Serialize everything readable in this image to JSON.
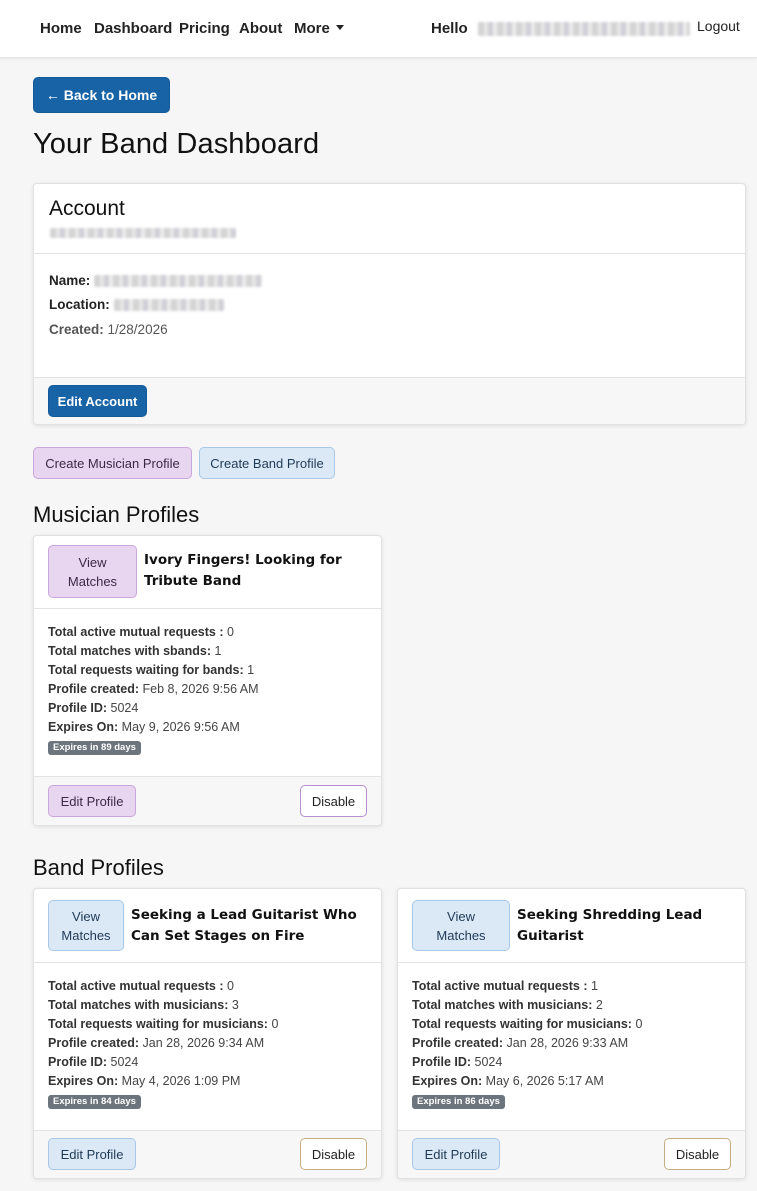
{
  "nav": {
    "items": [
      "Home",
      "Dashboard",
      "Pricing",
      "About"
    ],
    "more": "More",
    "hello": "Hello",
    "logout": "Logout"
  },
  "back_button": "← Back to Home",
  "page_title": "Your Band Dashboard",
  "account": {
    "title": "Account",
    "name_label": "Name:",
    "location_label": "Location:",
    "created_label": "Created:",
    "created_value": "1/28/2026",
    "edit_button": "Edit Account"
  },
  "actions": {
    "create_musician": "Create Musician Profile",
    "create_band": "Create Band Profile"
  },
  "musician_section": {
    "title": "Musician Profiles",
    "profiles": [
      {
        "view_matches": "View Matches",
        "title": "Ivory Fingers! Looking for Tribute Band",
        "stats": [
          {
            "label": "Total active mutual requests :",
            "value": "0"
          },
          {
            "label": "Total matches with sbands:",
            "value": "1"
          },
          {
            "label": "Total requests waiting for bands:",
            "value": "1"
          },
          {
            "label": "Profile created:",
            "value": "Feb 8, 2026 9:56 AM"
          },
          {
            "label": "Profile ID:",
            "value": "5024"
          },
          {
            "label": "Expires On:",
            "value": "May 9, 2026 9:56 AM"
          }
        ],
        "badge": "Expires in 89 days",
        "edit": "Edit Profile",
        "disable": "Disable"
      }
    ]
  },
  "band_section": {
    "title": "Band Profiles",
    "profiles": [
      {
        "view_matches": "View Matches",
        "title": "Seeking a Lead Guitarist Who Can Set Stages on Fire",
        "stats": [
          {
            "label": "Total active mutual requests :",
            "value": "0"
          },
          {
            "label": "Total matches with musicians:",
            "value": "3"
          },
          {
            "label": "Total requests waiting for musicians:",
            "value": "0"
          },
          {
            "label": "Profile created:",
            "value": "Jan 28, 2026 9:34 AM"
          },
          {
            "label": "Profile ID:",
            "value": "5024"
          },
          {
            "label": "Expires On:",
            "value": "May 4, 2026 1:09 PM"
          }
        ],
        "badge": "Expires in 84 days",
        "edit": "Edit Profile",
        "disable": "Disable"
      },
      {
        "view_matches": "View Matches",
        "title": "Seeking Shredding Lead Guitarist",
        "stats": [
          {
            "label": "Total active mutual requests :",
            "value": "1"
          },
          {
            "label": "Total matches with musicians:",
            "value": "2"
          },
          {
            "label": "Total requests waiting for musicians:",
            "value": "0"
          },
          {
            "label": "Profile created:",
            "value": "Jan 28, 2026 9:33 AM"
          },
          {
            "label": "Profile ID:",
            "value": "5024"
          },
          {
            "label": "Expires On:",
            "value": "May 6, 2026 5:17 AM"
          }
        ],
        "badge": "Expires in 86 days",
        "edit": "Edit Profile",
        "disable": "Disable"
      }
    ]
  },
  "colors": {
    "primary": "#1763a6",
    "musician_accent": "#e8d6f1",
    "band_accent": "#dbe9f7",
    "badge": "#6c757d"
  }
}
